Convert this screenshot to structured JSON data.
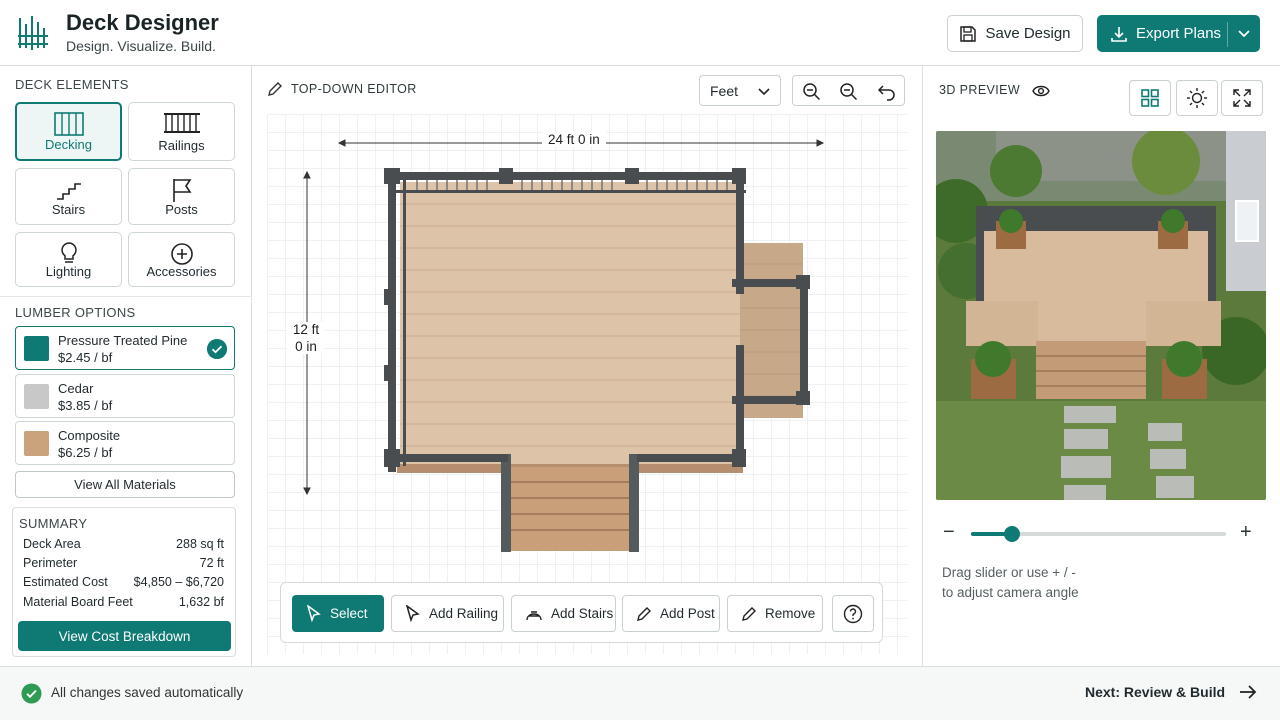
{
  "app": {
    "title": "Deck Designer",
    "subtitle": "Design. Visualize. Build."
  },
  "header": {
    "save_label": "Save Design",
    "export_label": "Export Plans"
  },
  "sidebar": {
    "elements_title": "DECK ELEMENTS",
    "elements": [
      {
        "label": "Decking",
        "icon": "decking-icon",
        "active": true
      },
      {
        "label": "Railings",
        "icon": "railing-icon",
        "active": false
      },
      {
        "label": "Stairs",
        "icon": "stairs-icon",
        "active": false
      },
      {
        "label": "Posts",
        "icon": "flag-icon",
        "active": false
      },
      {
        "label": "Lighting",
        "icon": "lightbulb-icon",
        "active": false
      },
      {
        "label": "Accessories",
        "icon": "plus-circle-icon",
        "active": false
      }
    ],
    "lumber_title": "LUMBER OPTIONS",
    "lumber": [
      {
        "name": "Pressure Treated Pine",
        "price": "$2.45 / bf",
        "color": "#0f7a73",
        "selected": true
      },
      {
        "name": "Cedar",
        "price": "$3.85 / bf",
        "color": "#c8c8c8",
        "selected": false
      },
      {
        "name": "Composite",
        "price": "$6.25 / bf",
        "color": "#c9a37c",
        "selected": false
      }
    ],
    "view_all_label": "View All Materials",
    "summary": {
      "title": "SUMMARY",
      "rows": [
        {
          "label": "Deck Area",
          "value": "288 sq ft"
        },
        {
          "label": "Perimeter",
          "value": "72 ft"
        },
        {
          "label": "Estimated Cost",
          "value": "$4,850 – $6,720"
        },
        {
          "label": "Material Board Feet",
          "value": "1,632 bf"
        }
      ],
      "button_label": "View Cost Breakdown"
    }
  },
  "editor": {
    "title": "TOP-DOWN EDITOR",
    "unit": "Feet",
    "width_label": "24 ft 0 in",
    "height_label_ft": "12 ft",
    "height_label_in": "0 in",
    "tools": [
      {
        "label": "Select",
        "icon": "cursor-icon",
        "active": true
      },
      {
        "label": "Add Railing",
        "icon": "cursor-icon",
        "active": false
      },
      {
        "label": "Add Stairs",
        "icon": "stairs-arc-icon",
        "active": false
      },
      {
        "label": "Add Post",
        "icon": "pencil-icon",
        "active": false
      },
      {
        "label": "Remove",
        "icon": "pencil-icon",
        "active": false
      }
    ]
  },
  "preview": {
    "title": "3D PREVIEW",
    "slider_value": 0.16,
    "hint_line1": "Drag slider or use + / -",
    "hint_line2": "to adjust camera angle"
  },
  "footer": {
    "status": "All changes saved automatically",
    "next_label": "Next: Review & Build"
  },
  "colors": {
    "accent": "#0f7a73",
    "deck_wood": "#d9bfa3",
    "railing": "#4a4d4f"
  }
}
